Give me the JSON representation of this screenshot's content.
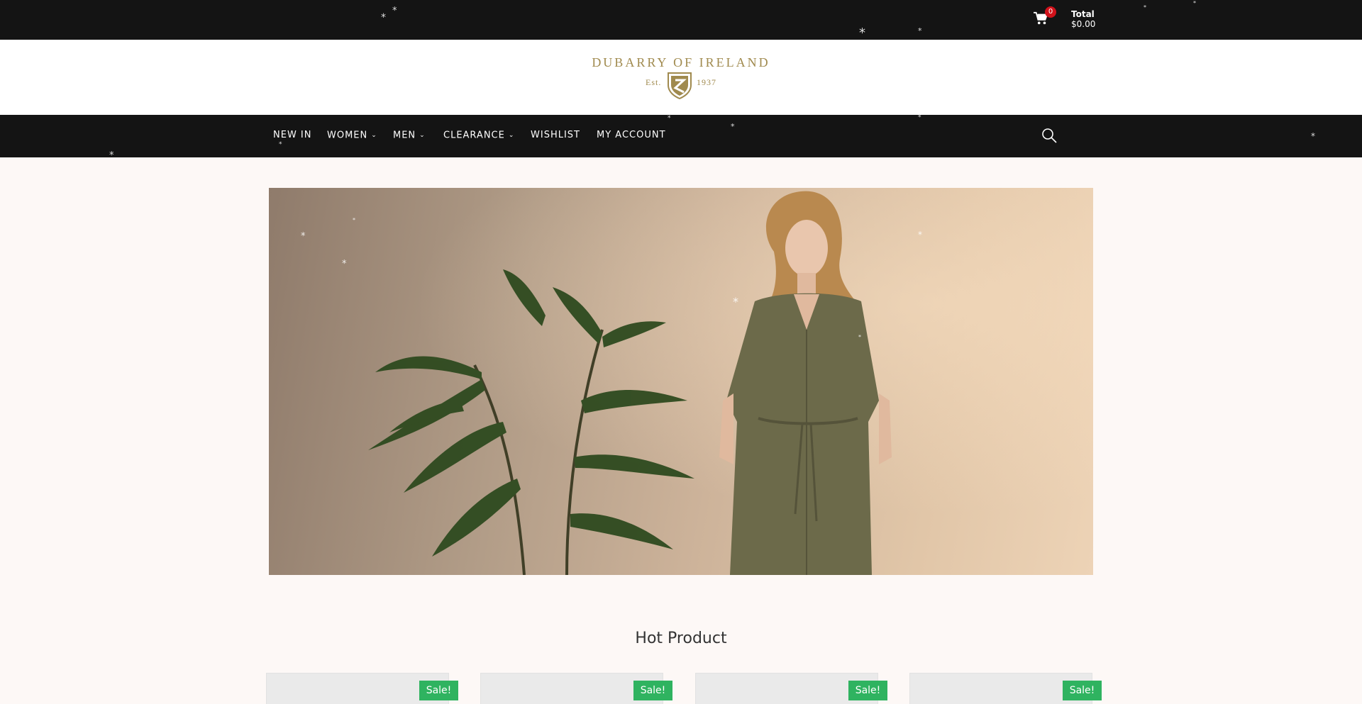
{
  "header": {
    "cart": {
      "count": "0",
      "total_label": "Total",
      "total_amount": "$0.00",
      "icon": "cart-icon"
    },
    "brand": {
      "name": "DUBARRY OF IRELAND",
      "est": "Est.",
      "year": "1937",
      "color": "#a08a4e"
    }
  },
  "nav": {
    "items": [
      {
        "label": "NEW IN"
      },
      {
        "label": "WOMEN"
      },
      {
        "label": "MEN"
      },
      {
        "label": "CLEARANCE"
      },
      {
        "label": "WISHLIST"
      },
      {
        "label": "MY ACCOUNT"
      }
    ],
    "search_icon": "search-icon"
  },
  "products_section": {
    "title": "Hot Product",
    "badge": "Sale!",
    "badge_color": "#2fb360"
  }
}
